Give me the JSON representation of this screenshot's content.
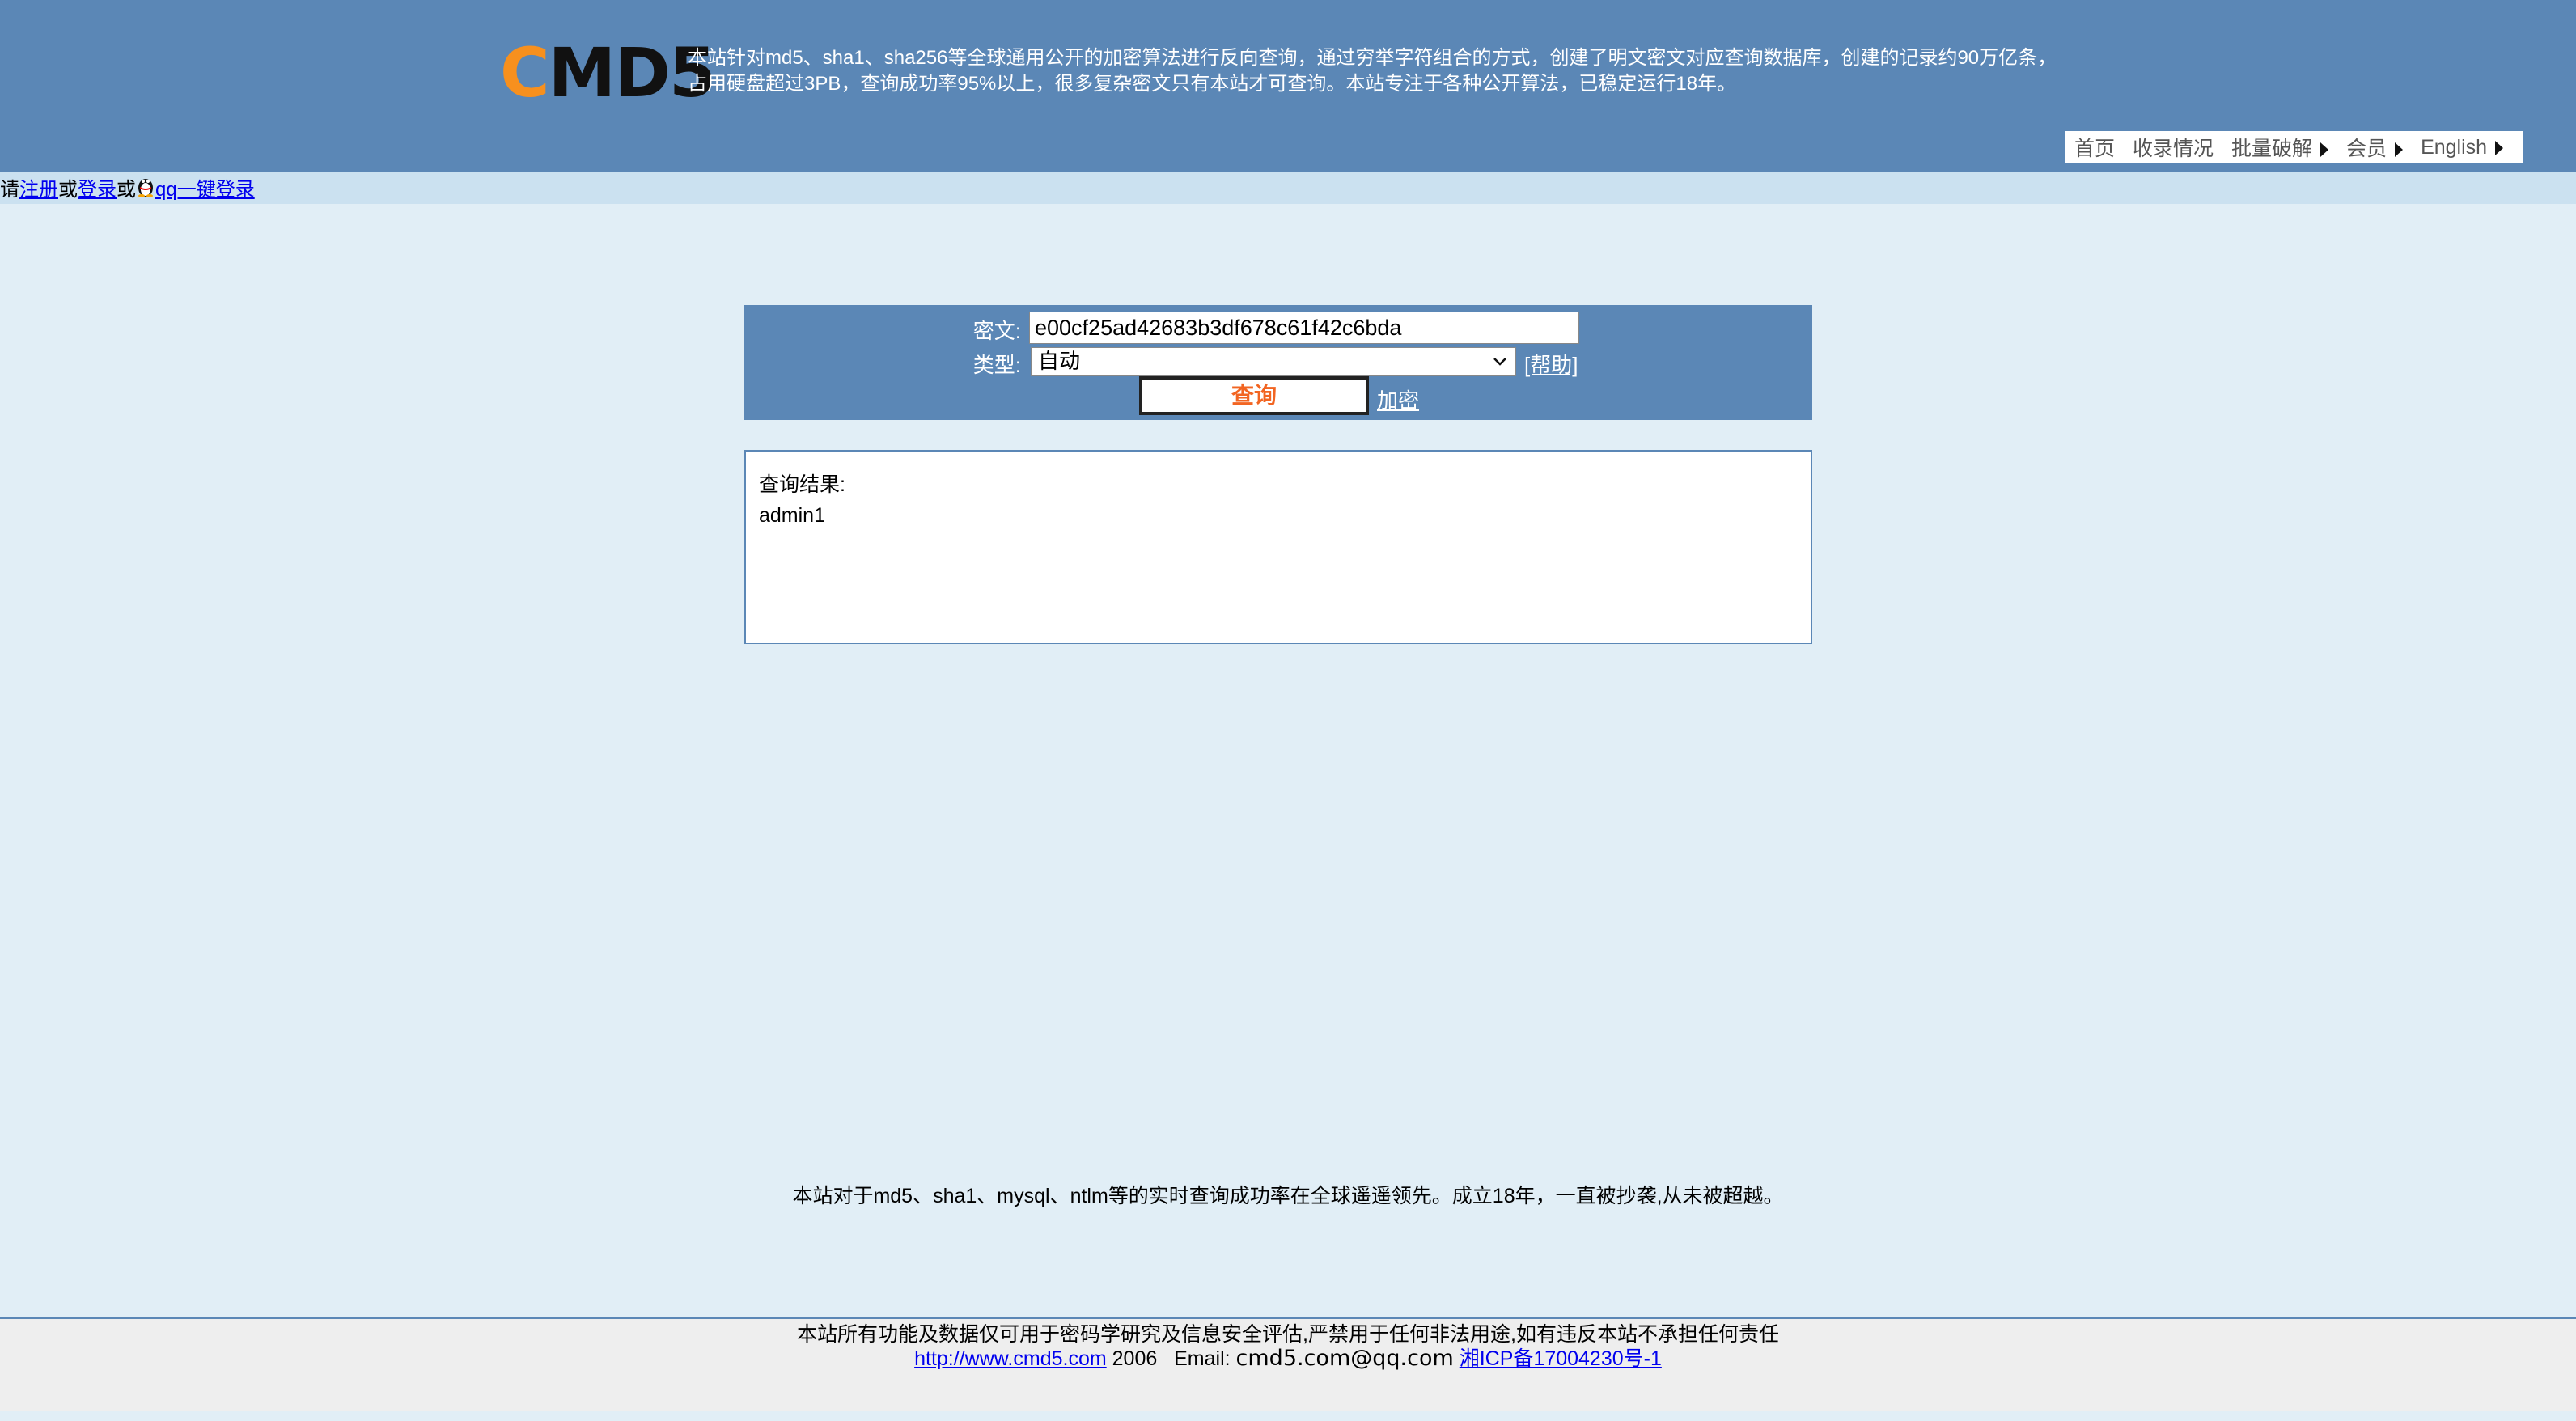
{
  "header": {
    "logo_c": "C",
    "logo_rest": "MD5",
    "intro_line1": "本站针对md5、sha1、sha256等全球通用公开的加密算法进行反向查询，通过穷举字符组合的方式，创建了明文密文对应查询数据库，创建的记录约90万亿条，",
    "intro_line2": "占用硬盘超过3PB，查询成功率95%以上，很多复杂密文只有本站才可查询。本站专注于各种公开算法，已稳定运行18年。"
  },
  "nav": {
    "items": [
      {
        "label": "首页"
      },
      {
        "label": "收录情况"
      },
      {
        "label": "批量破解"
      },
      {
        "label": "会员"
      },
      {
        "label": "English"
      }
    ]
  },
  "login_bar": {
    "prefix": "请",
    "register": "注册",
    "or1": "或",
    "login": "登录",
    "or2": "或",
    "qq_login": "qq一键登录"
  },
  "query_form": {
    "cipher_label": "密文:",
    "cipher_value": "e00cf25ad42683b3df678c61f42c6bda",
    "type_label": "类型:",
    "type_value": "自动",
    "help": "[帮助]",
    "query_button": "查询",
    "encrypt_link": "加密"
  },
  "result": {
    "title": "查询结果:",
    "value": "admin1"
  },
  "notice": "本站对于md5、sha1、mysql、ntlm等的实时查询成功率在全球遥遥领先。成立18年，一直被抄袭,从未被超越。",
  "footer": {
    "line1": "本站所有功能及数据仅可用于密码学研究及信息安全评估,严禁用于任何非法用途,如有违反本站不承担任何责任",
    "url": "http://www.cmd5.com",
    "year": "2006",
    "email_label": "Email:",
    "email": "cmd5.com@qq.com",
    "icp": "湘ICP备17004230号-1"
  }
}
